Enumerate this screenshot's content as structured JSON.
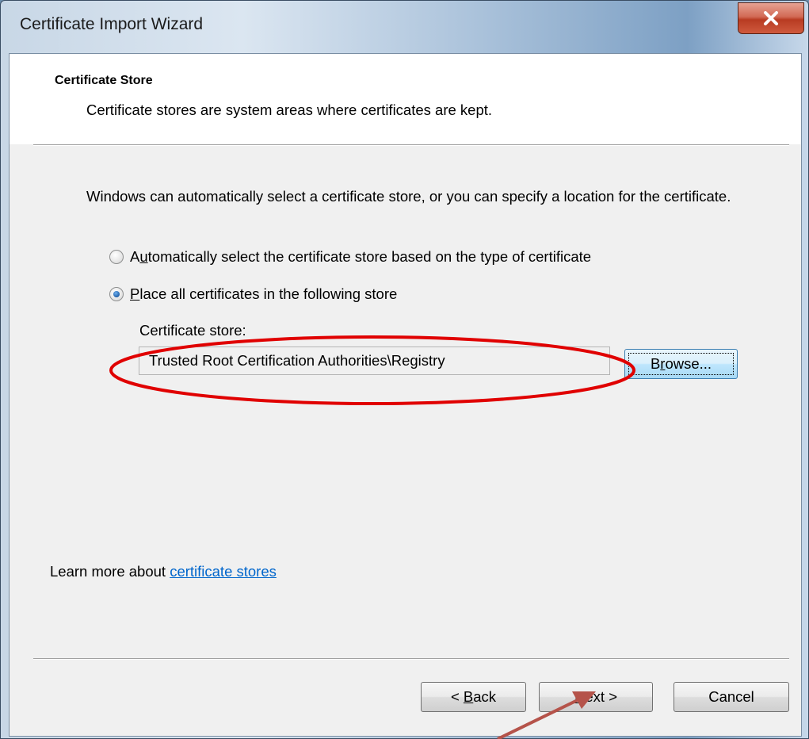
{
  "window": {
    "title": "Certificate Import Wizard",
    "close_glyph": "X"
  },
  "header": {
    "title": "Certificate Store",
    "subtitle": "Certificate stores are system areas where certificates are kept."
  },
  "body": {
    "intro": "Windows can automatically select a certificate store, or you can specify a location for the certificate."
  },
  "options": {
    "auto": {
      "pre": "A",
      "key": "u",
      "post": "tomatically select the certificate store based on the type of certificate",
      "selected": false
    },
    "place": {
      "pre": "",
      "key": "P",
      "post": "lace all certificates in the following store",
      "selected": true
    }
  },
  "store": {
    "label": "Certificate store:",
    "value": "Trusted Root Certification Authorities\\Registry",
    "browse": {
      "pre": "B",
      "key": "r",
      "post": "owse..."
    }
  },
  "learn": {
    "prefix": "Learn more about ",
    "link": "certificate stores"
  },
  "footer": {
    "back": {
      "pre": "< ",
      "key": "B",
      "post": "ack"
    },
    "next": {
      "pre": "",
      "key": "N",
      "post": "ext >"
    },
    "cancel": "Cancel"
  },
  "colors": {
    "annotation": "#e00000",
    "arrow": "#b5534a",
    "link": "#0066cc"
  }
}
